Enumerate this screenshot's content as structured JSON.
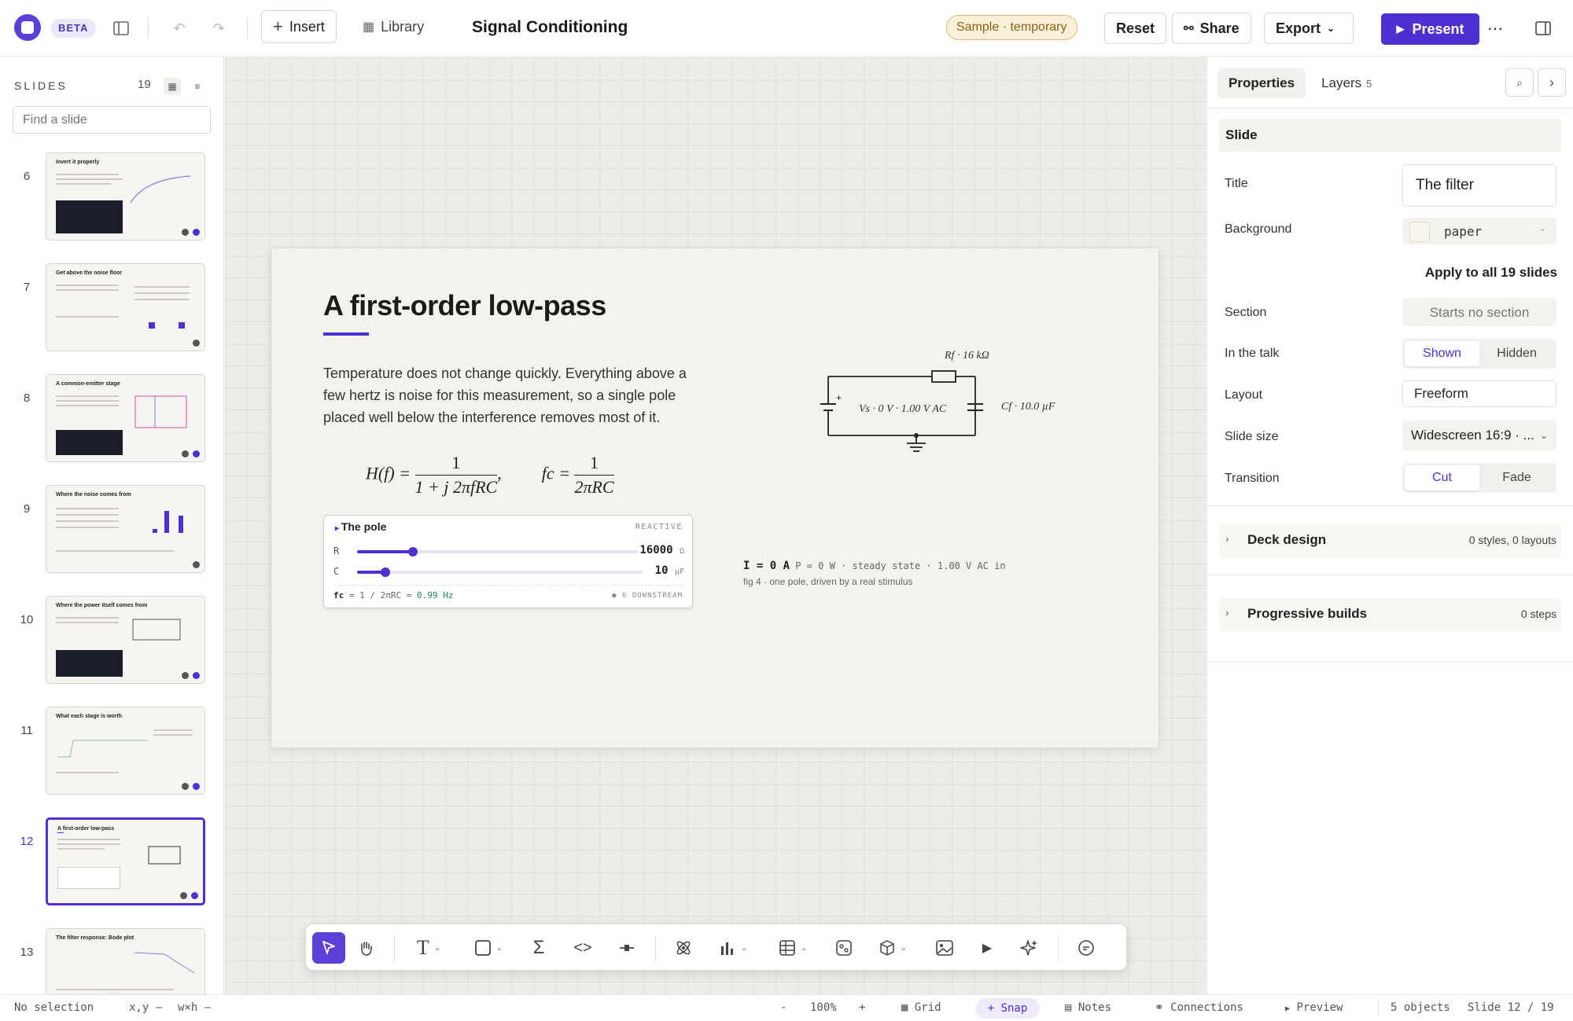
{
  "topbar": {
    "beta": "BETA",
    "insert_label": "Insert",
    "library_label": "Library",
    "document_title": "Signal Conditioning",
    "sample_badge": "Sample · temporary",
    "reset_label": "Reset",
    "share_label": "Share",
    "export_label": "Export",
    "present_label": "Present"
  },
  "sidebar": {
    "heading": "SLIDES",
    "count": "19",
    "find_placeholder": "Find a slide",
    "slides": [
      {
        "number": "6",
        "title": "Invert it properly"
      },
      {
        "number": "7",
        "title": "Get above the noise floor"
      },
      {
        "number": "8",
        "title": "A common-emitter stage"
      },
      {
        "number": "9",
        "title": "Where the noise comes from"
      },
      {
        "number": "10",
        "title": "Where the power itself comes from"
      },
      {
        "number": "11",
        "title": "What each stage is worth"
      },
      {
        "number": "12",
        "title": "A first-order low-pass"
      },
      {
        "number": "13",
        "title": "The filter response: Bode plot"
      }
    ],
    "active_slide": "12",
    "add_label": "+"
  },
  "slide": {
    "title": "A first-order low-pass",
    "body": "Temperature does not change quickly. Everything above a few hertz is noise for this measurement, so a single pole placed well below the interference removes most of it.",
    "equation": {
      "lhs": "H(f) =",
      "num": "1",
      "den": "1 + j 2πfRC",
      "comma": ",",
      "fc_lhs": "fc =",
      "fc_num": "1",
      "fc_den": "2πRC"
    },
    "pole_widget": {
      "title": "The pole",
      "tag": "REACTIVE",
      "r_label": "R",
      "r_value": "16000",
      "r_unit": "Ω",
      "r_fraction": 0.2,
      "c_label": "C",
      "c_value": "10",
      "c_unit": "µF",
      "c_fraction": 0.1,
      "formula_prefix": "fc",
      "formula": " = 1 / 2πRC = ",
      "formula_value": "0.99 Hz",
      "downstream": "● 6 DOWNSTREAM"
    },
    "circuit": {
      "resistor_label": "Rf · 16 kΩ",
      "source_label": "Vs · 0 V · 1.00 V AC",
      "capacitor_label": "Cf · 10.0 µF"
    },
    "readout": {
      "current": "I = 0 A",
      "detail": "P = 0 W · steady state · 1.00 V AC in"
    },
    "caption": "fig 4 · one pole, driven by a real stimulus"
  },
  "toolbar": {
    "tools": [
      "select-tool",
      "hand-tool",
      "text-tool",
      "shape-tool",
      "sigma-tool",
      "code-tool",
      "connector-tool",
      "atom-tool",
      "chart-tool",
      "table-tool",
      "widget-tool",
      "3d-tool",
      "image-tool",
      "play-tool",
      "ai-sparkle-tool",
      "comment-tool"
    ]
  },
  "properties": {
    "tab_properties": "Properties",
    "tab_layers": "Layers",
    "layers_count": "5",
    "section_header": "Slide",
    "title_label": "Title",
    "title_value": "The filter",
    "background_label": "Background",
    "background_value": "paper",
    "apply_all": "Apply to all 19 slides",
    "section_label": "Section",
    "section_value": "Starts no section",
    "in_talk_label": "In the talk",
    "shown": "Shown",
    "hidden": "Hidden",
    "layout_label": "Layout",
    "layout_value": "Freeform",
    "slide_size_label": "Slide size",
    "slide_size_value": "Widescreen 16:9 · ...",
    "transition_label": "Transition",
    "cut": "Cut",
    "fade": "Fade",
    "deck_design": "Deck design",
    "deck_design_meta": "0 styles, 0 layouts",
    "progressive_builds": "Progressive builds",
    "progressive_meta": "0 steps"
  },
  "statusbar": {
    "selection": "No selection",
    "xy": "x,y —",
    "wh": "w×h —",
    "zoom_minus": "-",
    "zoom": "100%",
    "zoom_plus": "+",
    "grid": "Grid",
    "snap": "Snap",
    "notes": "Notes",
    "connections": "Connections",
    "preview": "Preview",
    "objects": "5 objects",
    "slide_pos": "Slide 12 / 19"
  }
}
